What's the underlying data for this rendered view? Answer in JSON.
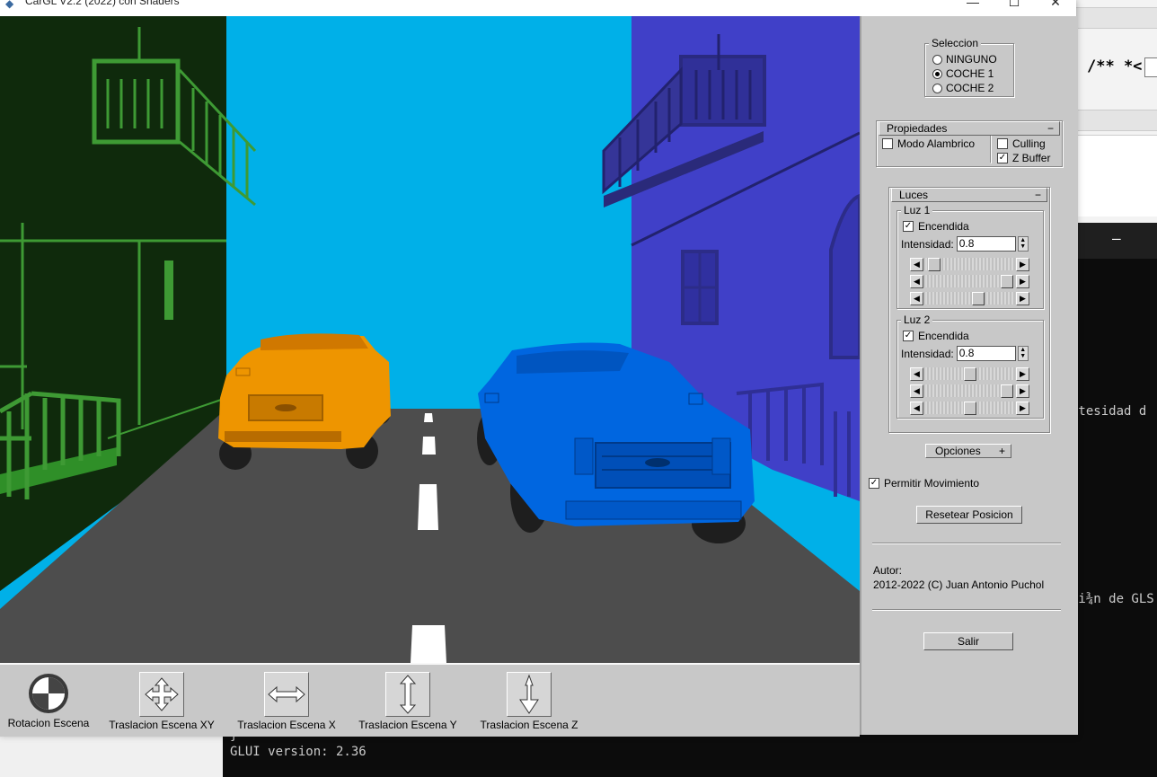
{
  "window": {
    "title": "CarGL V2.2 (2022) con Shaders",
    "controls": {
      "minimize": "—",
      "maximize": "☐",
      "close": "✕"
    }
  },
  "background": {
    "editor_code": "/** *<",
    "console_lines": [
      "ntesidad d",
      "si¾n de GLS",
      "}",
      "GLUI version: 2.36"
    ]
  },
  "scene": {
    "sky_color": "#00b0e8",
    "road_color": "#4d4d4d",
    "car1_color": "#ee9500",
    "car2_color": "#0066e0",
    "left_building_color": "#0f2a0c",
    "right_building_color": "#4040c8"
  },
  "panel": {
    "seleccion": {
      "title": "Seleccion",
      "options": [
        "NINGUNO",
        "COCHE 1",
        "COCHE 2"
      ],
      "selected": "COCHE 1"
    },
    "propiedades": {
      "title": "Propiedades",
      "toggle": "−",
      "modo_alambrico": {
        "label": "Modo Alambrico",
        "checked": false
      },
      "culling": {
        "label": "Culling",
        "checked": false
      },
      "zbuffer": {
        "label": "Z Buffer",
        "checked": true
      }
    },
    "luces": {
      "title": "Luces",
      "toggle": "−",
      "luz1": {
        "title": "Luz 1",
        "encendida_label": "Encendida",
        "encendida": true,
        "intensidad_label": "Intensidad:",
        "intensidad": "0.8",
        "sliders": [
          0.05,
          0.95,
          0.6
        ]
      },
      "luz2": {
        "title": "Luz 2",
        "encendida_label": "Encendida",
        "encendida": true,
        "intensidad_label": "Intensidad:",
        "intensidad": "0.8",
        "sliders": [
          0.5,
          0.95,
          0.5
        ]
      }
    },
    "opciones": {
      "label": "Opciones",
      "toggle": "+"
    },
    "permitir_movimiento": {
      "label": "Permitir Movimiento",
      "checked": true
    },
    "resetear_label": "Resetear Posicion",
    "autor_label": "Autor:",
    "autor_text": "2012-2022 (C) Juan Antonio Puchol",
    "salir_label": "Salir"
  },
  "toolbar": [
    {
      "label": "Rotacion Escena",
      "icon": "rotation-sphere-icon"
    },
    {
      "label": "Traslacion Escena XY",
      "icon": "move-xy-icon"
    },
    {
      "label": "Traslacion Escena X",
      "icon": "move-x-icon"
    },
    {
      "label": "Traslacion Escena Y",
      "icon": "move-y-icon"
    },
    {
      "label": "Traslacion Escena Z",
      "icon": "move-z-icon"
    }
  ]
}
